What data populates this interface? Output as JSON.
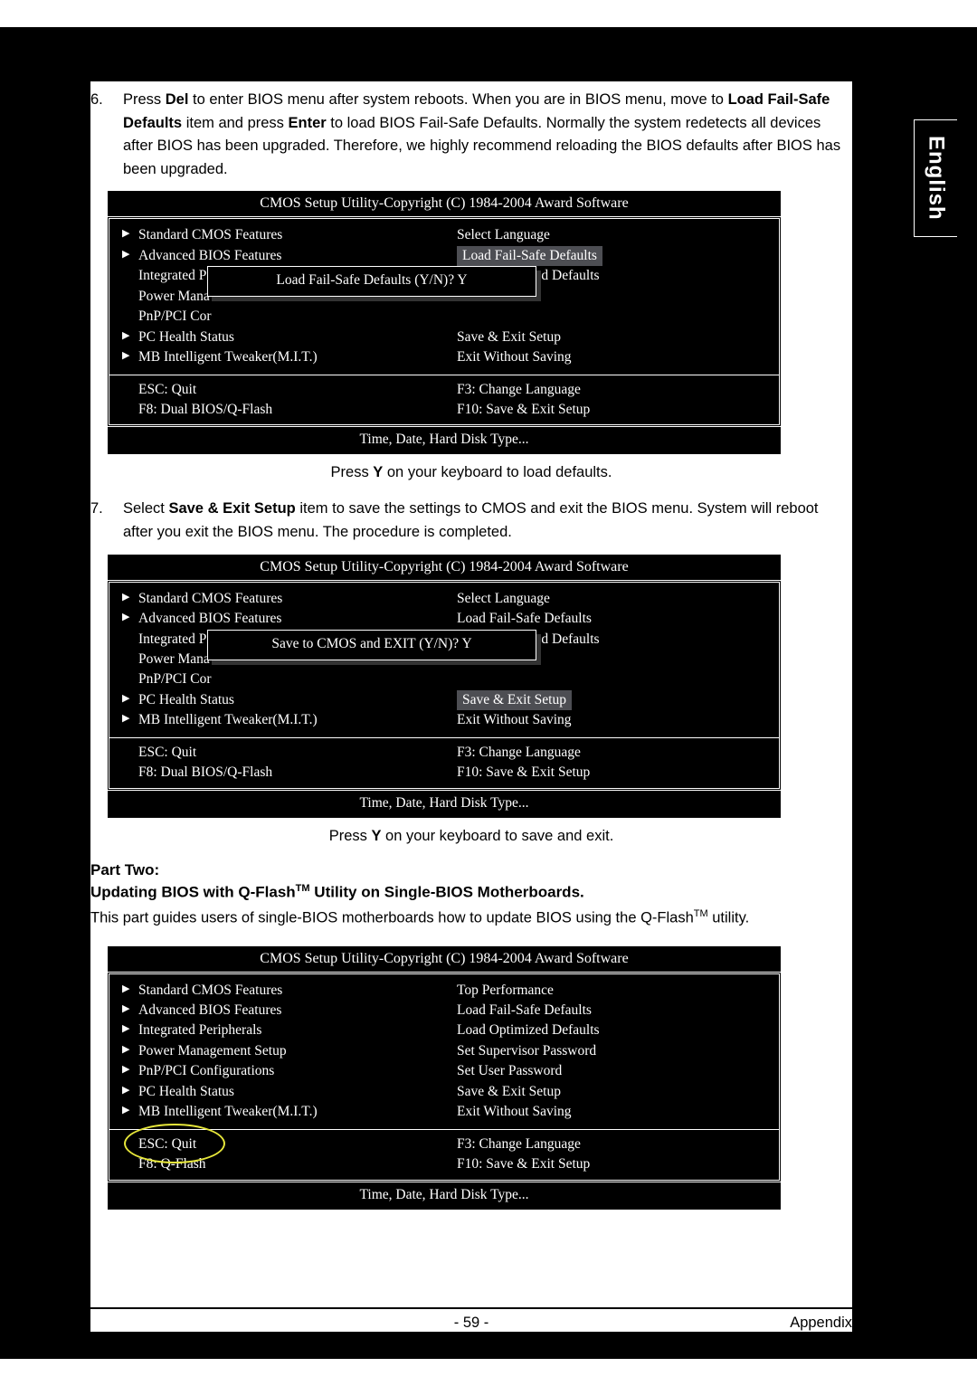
{
  "sidetab": "English",
  "step6": {
    "num": "6.",
    "t1a": "Press ",
    "t1b": "Del",
    "t1c": " to enter BIOS menu after system reboots. When you are in BIOS menu, move to ",
    "t2a": "Load Fail-Safe Defaults",
    "t2b": " item and press ",
    "t2c": "Enter",
    "t2d": " to load BIOS Fail-Safe Defaults. Normally the system redetects all devices after BIOS has been upgraded. Therefore, we highly recommend reloading the BIOS defaults after BIOS has been upgraded."
  },
  "bios_title": "CMOS Setup Utility-Copyright (C) 1984-2004 Award Software",
  "bios_help": "Time, Date, Hard Disk Type...",
  "m1_left": [
    "Standard CMOS Features",
    "Advanced BIOS Features",
    "Integrated Peripherals",
    "Power Mana",
    "PnP/PCI Cor",
    "PC Health Status",
    "MB Intelligent Tweaker(M.I.T.)"
  ],
  "m1_right": [
    "Select Language",
    "Load Fail-Safe Defaults",
    "Load Optimized Defaults",
    "",
    "",
    "Save & Exit Setup",
    "Exit Without Saving"
  ],
  "m1_dialog": "Load Fail-Safe Defaults (Y/N)? Y",
  "foot_left": [
    "ESC: Quit",
    "F8: Dual BIOS/Q-Flash"
  ],
  "foot_right": [
    "F3: Change Language",
    "F10: Save & Exit Setup"
  ],
  "caption1a": "Press ",
  "caption1b": "Y",
  "caption1c": " on your keyboard to load defaults.",
  "step7": {
    "num": "7.",
    "t1a": "Select ",
    "t1b": "Save & Exit Setup",
    "t1c": " item to save the settings to CMOS and exit the BIOS menu. System will reboot after you exit the BIOS menu. The procedure is completed."
  },
  "m2_dialog": "Save to CMOS and EXIT (Y/N)? Y",
  "m2_right": [
    "Select Language",
    "Load Fail-Safe Defaults",
    "Load Optimized Defaults",
    "",
    "",
    "Save & Exit Setup",
    "Exit Without Saving"
  ],
  "caption2a": "Press ",
  "caption2b": "Y",
  "caption2c": " on your keyboard to save and exit.",
  "part2": "Part Two:",
  "part2sub_a": "Updating BIOS with Q-Flash",
  "part2sub_b": "TM",
  "part2sub_c": " Utility on Single-BIOS Motherboards.",
  "part2para_a": "This part guides users of single-BIOS motherboards how to update BIOS using the Q-Flash",
  "part2para_b": "TM",
  "part2para_c": " utility.",
  "m3_left": [
    "Standard CMOS Features",
    "Advanced BIOS Features",
    "Integrated Peripherals",
    "Power Management Setup",
    "PnP/PCI Configurations",
    "PC Health Status",
    "MB Intelligent Tweaker(M.I.T.)"
  ],
  "m3_right": [
    "Top Performance",
    "Load Fail-Safe Defaults",
    "Load Optimized Defaults",
    "Set Supervisor Password",
    "Set User Password",
    "Save & Exit Setup",
    "Exit Without Saving"
  ],
  "foot3_left": [
    "ESC: Quit",
    "F8: Q-Flash"
  ],
  "pagenum": "- 59 -",
  "appendix": "Appendix"
}
